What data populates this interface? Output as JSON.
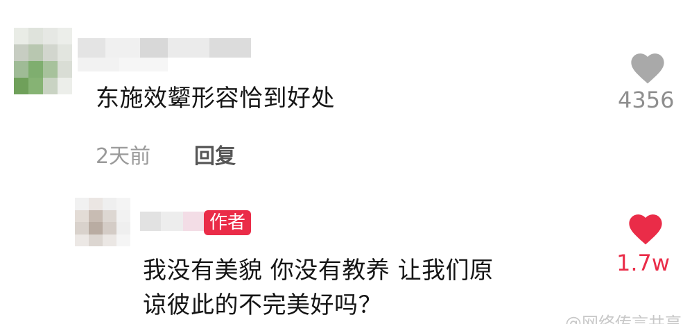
{
  "comments": [
    {
      "text": "东施效颦形容恰到好处",
      "time": "2天前",
      "reply_label": "回复",
      "like_count": "4356",
      "liked": false
    },
    {
      "badge": "作者",
      "text_line1": "我没有美貌 你没有教养 让我们原",
      "text_line2": "谅彼此的不完美好吗？",
      "like_count": "1.7w",
      "liked": true
    }
  ],
  "watermark": "@网络传言共享",
  "colors": {
    "liked": "#ea2c48",
    "unliked": "#a9a9a9",
    "badge": "#ea2c48"
  }
}
